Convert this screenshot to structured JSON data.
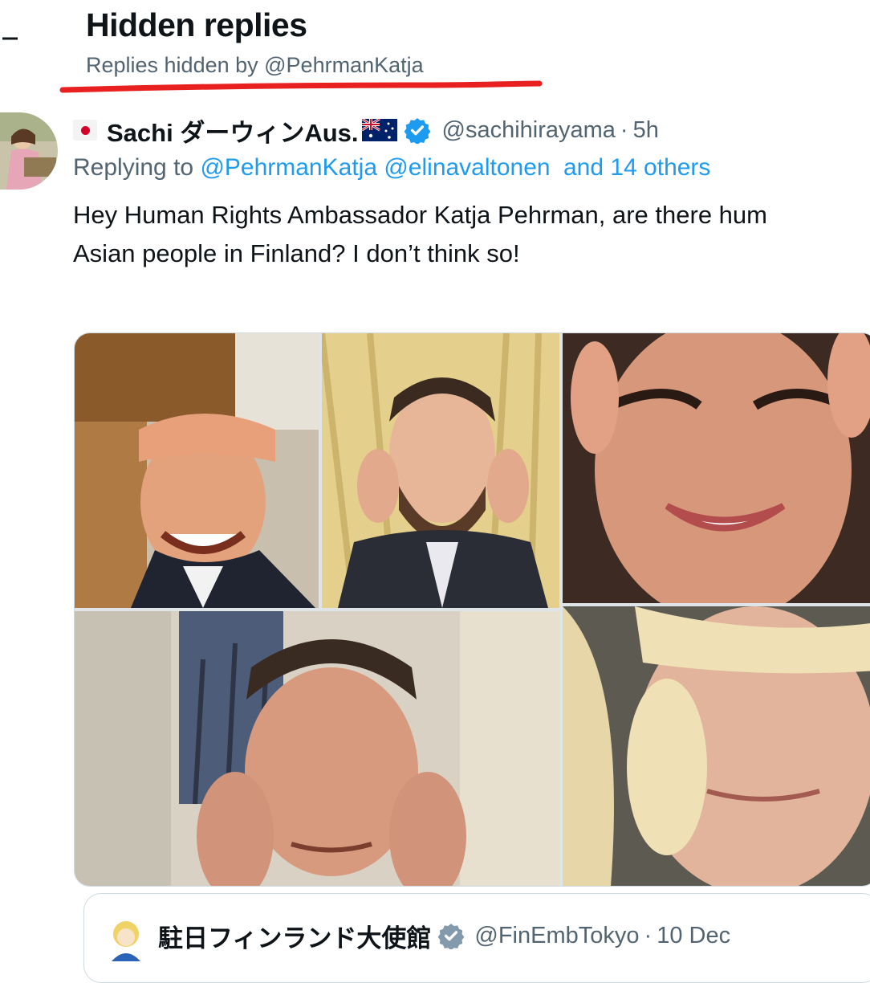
{
  "header": {
    "title": "Hidden replies",
    "subtitle": "Replies hidden by @PehrmanKatja"
  },
  "tweet": {
    "display_name": "Sachi ダーウィンAus.",
    "handle": "@sachihirayama",
    "separator": "·",
    "time": "5h",
    "replying_prefix": "Replying to ",
    "mention_1": "@PehrmanKatja",
    "mention_2": "@elinavaltonen",
    "others": "and 14 others",
    "text_line_1": "Hey Human Rights Ambassador Katja Pehrman, are there hum",
    "text_line_2": "Asian people in Finland? I don’t think so!"
  },
  "quote": {
    "display_name": "駐日フィンランド大使館",
    "handle": "@FinEmbTokyo",
    "separator": "·",
    "time": "10 Dec"
  },
  "colors": {
    "accent": "#1d9bf0",
    "secondary_text": "#536471",
    "primary_text": "#0f1419",
    "annotation_red": "#e8201f"
  },
  "icons": {
    "back": "back-arrow-icon",
    "verified": "verified-badge-icon",
    "jp_flag": "japan-flag-emoji",
    "au_flag": "australia-flag-emoji"
  }
}
